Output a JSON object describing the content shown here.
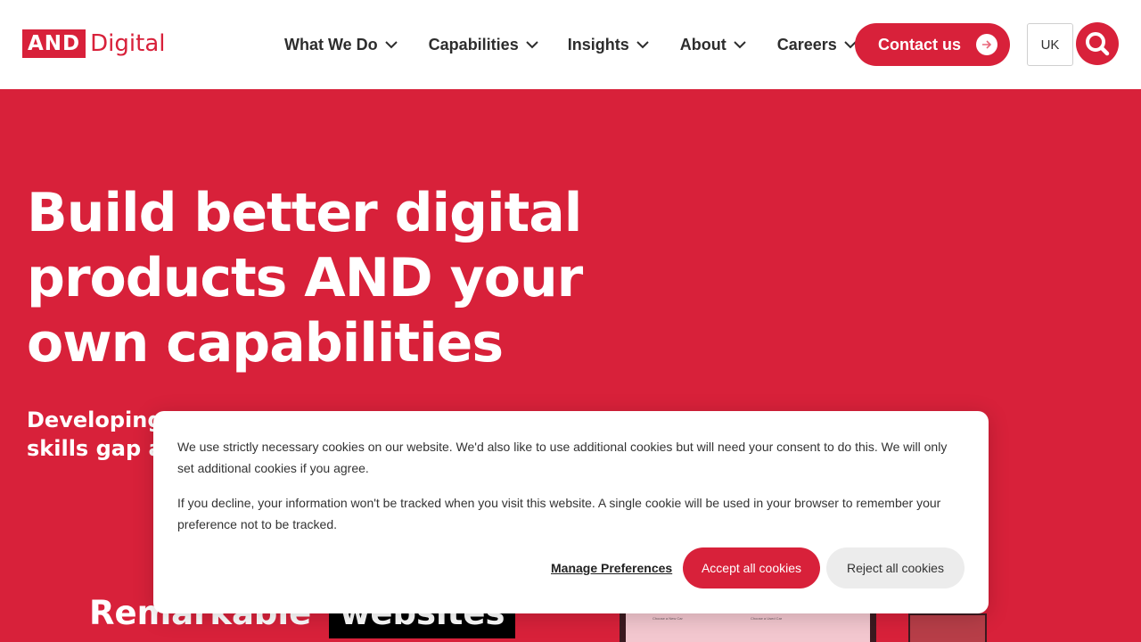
{
  "header": {
    "logo": {
      "mark": "AND",
      "text": "Digital"
    },
    "nav": [
      {
        "label": "What We Do"
      },
      {
        "label": "Capabilities"
      },
      {
        "label": "Insights"
      },
      {
        "label": "About"
      },
      {
        "label": "Careers"
      }
    ],
    "contact_label": "Contact us",
    "region_label": "UK"
  },
  "hero": {
    "title_lines": [
      "Build better digital",
      "products AND your",
      "own capabilities"
    ],
    "subtitle_lines": [
      "Developing",
      "skills gap ar"
    ]
  },
  "section": {
    "title": "Remarkable",
    "tag": "websites"
  },
  "preview": {
    "col1_title": "Choose a New Car",
    "col2_title": "Choose a Used Car"
  },
  "cookie_banner": {
    "paragraph1": "We use strictly necessary cookies on our website. We'd also like to use additional cookies but will need your consent to do this. We will only set additional cookies if you agree.",
    "paragraph2": "If you decline, your information won't be tracked when you visit this website. A single cookie will be used in your browser to remember your preference not to be tracked.",
    "manage_label": "Manage Preferences",
    "accept_label": "Accept all cookies",
    "reject_label": "Reject all cookies"
  },
  "colors": {
    "brand_red": "#d8213a",
    "nav_text": "#2d2d2d",
    "reject_bg": "#ececec"
  }
}
